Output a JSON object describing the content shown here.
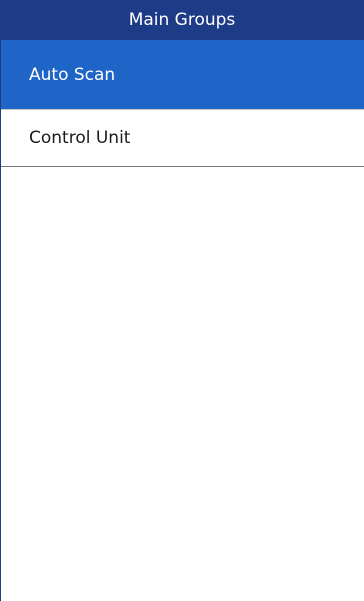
{
  "header": {
    "title": "Main Groups"
  },
  "menu": {
    "items": [
      {
        "label": "Auto Scan",
        "selected": true
      },
      {
        "label": "Control Unit",
        "selected": false
      }
    ]
  },
  "colors": {
    "title_bar": "#1d3b86",
    "selected_item": "#1f64c7",
    "divider": "#6f7680"
  }
}
